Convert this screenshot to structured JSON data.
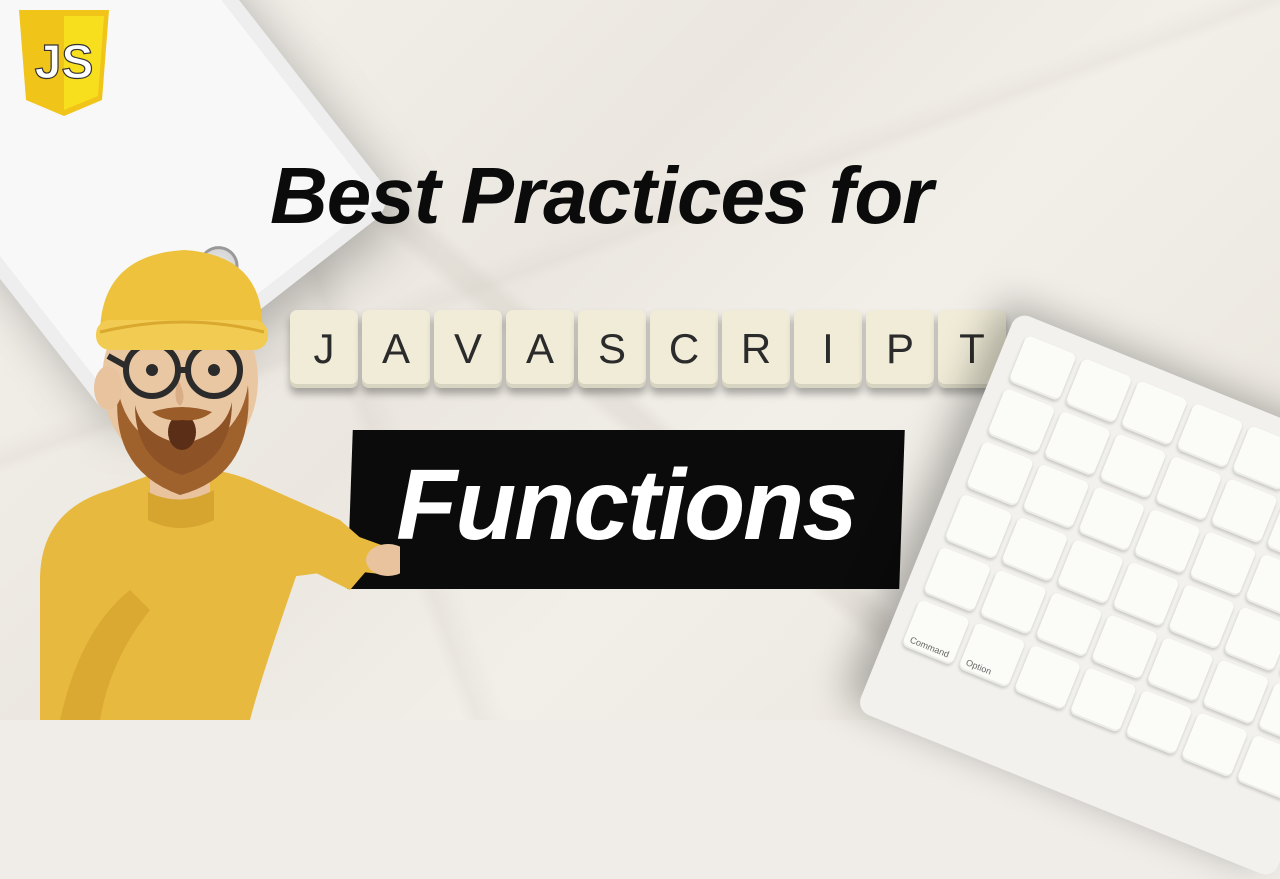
{
  "logo": {
    "text": "JS"
  },
  "headline": "Best Practices for",
  "tiles": [
    "J",
    "A",
    "V",
    "A",
    "S",
    "C",
    "R",
    "I",
    "P",
    "T"
  ],
  "functions": "Functions",
  "keyboard_labels": [
    "Command",
    "Option"
  ],
  "colors": {
    "js_yellow": "#f7df1e",
    "js_dark": "#e6a817",
    "text_dark": "#0b0b0b",
    "tile_bg": "#f0ecd8",
    "shirt": "#e8b93f"
  }
}
